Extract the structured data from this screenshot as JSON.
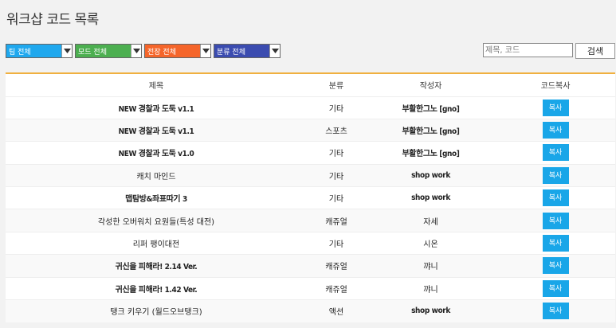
{
  "page": {
    "title": "워크샵 코드 목록"
  },
  "filters": [
    {
      "name": "team",
      "label": "팀 전체",
      "color": "#1fa8ee"
    },
    {
      "name": "mode",
      "label": "모드 전체",
      "color": "#4caf50"
    },
    {
      "name": "battlefield",
      "label": "전장 전체",
      "color": "#f5652a"
    },
    {
      "name": "category",
      "label": "분류 전체",
      "color": "#3b4cb0"
    }
  ],
  "search": {
    "placeholder": "제목, 코드",
    "button_label": "검색"
  },
  "table": {
    "headers": [
      "제목",
      "분류",
      "작성자",
      "코드복사"
    ],
    "rows": [
      {
        "title": "NEW 경찰과 도둑 v1.1",
        "category": "기타",
        "author": "부활한그노 [gno]",
        "copy": "복사"
      },
      {
        "title": "NEW 경찰과 도둑 v1.1",
        "category": "스포츠",
        "author": "부활한그노 [gno]",
        "copy": "복사"
      },
      {
        "title": "NEW 경찰과 도둑 v1.0",
        "category": "기타",
        "author": "부활한그노 [gno]",
        "copy": "복사"
      },
      {
        "title": "캐치 마인드",
        "category": "기타",
        "author": "shop work",
        "copy": "복사"
      },
      {
        "title": "맵탐방&좌표따기 3",
        "category": "기타",
        "author": "shop work",
        "copy": "복사"
      },
      {
        "title": "각성한 오버워치 요원들(특성 대전)",
        "category": "캐쥬얼",
        "author": "자세",
        "copy": "복사"
      },
      {
        "title": "리퍼 팽이대전",
        "category": "기타",
        "author": "시온",
        "copy": "복사"
      },
      {
        "title": "귀신을 피해라! 2.14 Ver.",
        "category": "캐쥬얼",
        "author": "꺄니",
        "copy": "복사"
      },
      {
        "title": "귀신을 피해라! 1.42 Ver.",
        "category": "캐쥬얼",
        "author": "꺄니",
        "copy": "복사"
      },
      {
        "title": "탱크 키우기 (월드오브탱크)",
        "category": "액션",
        "author": "shop work",
        "copy": "복사"
      }
    ]
  }
}
